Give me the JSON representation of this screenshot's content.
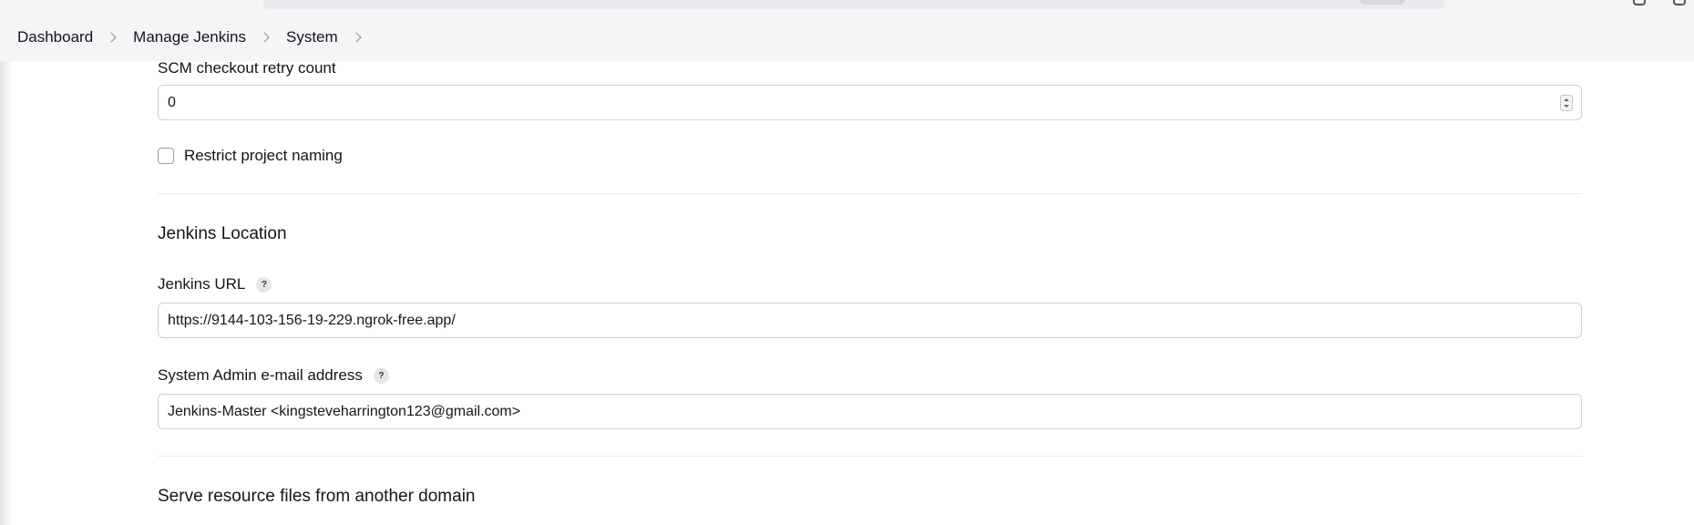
{
  "breadcrumb": [
    "Dashboard",
    "Manage Jenkins",
    "System"
  ],
  "scm_retry": {
    "label": "SCM checkout retry count",
    "value": "0"
  },
  "restrict_naming": {
    "label": "Restrict project naming",
    "checked": false
  },
  "jenkins_location": {
    "title": "Jenkins Location",
    "url_label": "Jenkins URL",
    "url_value": "https://9144-103-156-19-229.ngrok-free.app/",
    "email_label": "System Admin e-mail address",
    "email_value": "Jenkins-Master <kingsteveharrington123@gmail.com>",
    "help_glyph": "?"
  },
  "serve_resources": {
    "title": "Serve resource files from another domain"
  },
  "colors": {
    "header_bg": "#f5f5f7",
    "input_border": "#cfcfd6",
    "text": "#14141f"
  },
  "icons": {
    "chevron": "chevron-right-icon",
    "help": "help-icon",
    "spinner": "number-spinner-icon"
  }
}
